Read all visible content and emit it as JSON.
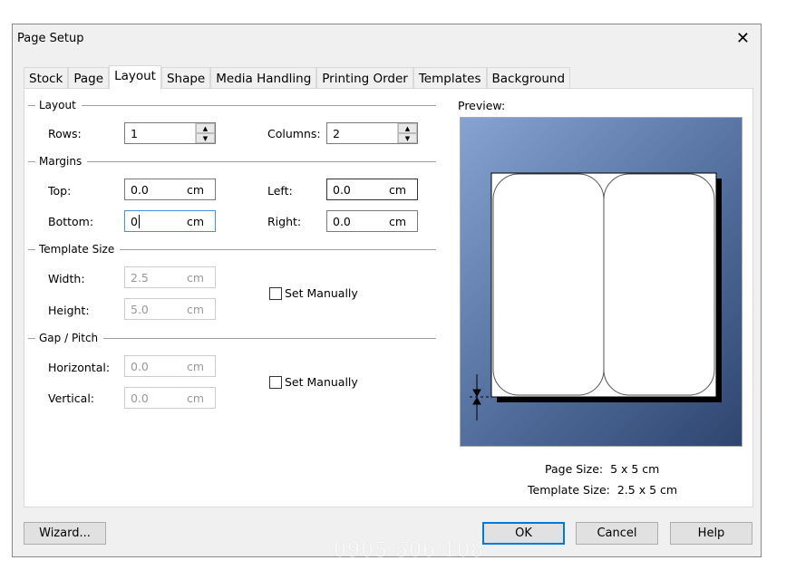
{
  "window": {
    "title": "Page Setup"
  },
  "tabs": [
    "Stock",
    "Page",
    "Layout",
    "Shape",
    "Media Handling",
    "Printing Order",
    "Templates",
    "Background"
  ],
  "active_tab": "Layout",
  "layout": {
    "section": "Layout",
    "rows_label": "Rows:",
    "rows": "1",
    "columns_label": "Columns:",
    "columns": "2"
  },
  "margins": {
    "section": "Margins",
    "top_label": "Top:",
    "top": "0.0",
    "left_label": "Left:",
    "left": "0.0",
    "bottom_label": "Bottom:",
    "bottom": "0",
    "right_label": "Right:",
    "right": "0.0",
    "unit": "cm"
  },
  "template_size": {
    "section": "Template Size",
    "width_label": "Width:",
    "width": "2.5",
    "height_label": "Height:",
    "height": "5.0",
    "set_manually": "Set Manually",
    "unit": "cm"
  },
  "gap": {
    "section": "Gap / Pitch",
    "horizontal_label": "Horizontal:",
    "horizontal": "0.0",
    "vertical_label": "Vertical:",
    "vertical": "0.0",
    "set_manually": "Set Manually",
    "unit": "cm"
  },
  "preview": {
    "label": "Preview:",
    "page_size_label": "Page Size:",
    "page_size": "5 x 5 cm",
    "template_size_label": "Template Size:",
    "template_size": "2.5 x 5 cm"
  },
  "buttons": {
    "wizard": "Wizard...",
    "ok": "OK",
    "cancel": "Cancel",
    "help": "Help"
  },
  "watermark": "0905 506 108"
}
